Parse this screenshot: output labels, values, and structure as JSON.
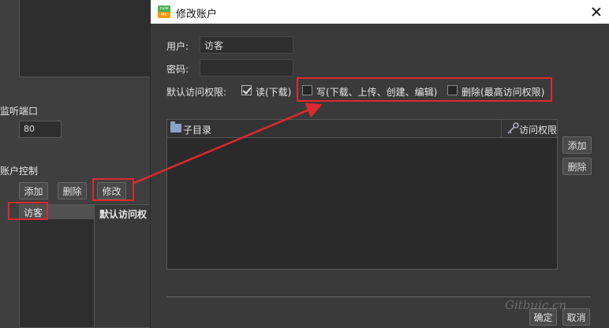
{
  "background": {
    "port_label": "监听端口",
    "port_value": "80",
    "account_label": "账户控制",
    "add_button": "添加",
    "delete_button": "删除",
    "modify_button": "修改",
    "accounts": [
      "访客"
    ],
    "default_perm_header": "默认访问权"
  },
  "dialog": {
    "title": "修改账户",
    "logo_top": "cute",
    "logo_bottom": "ME",
    "user_label": "用户:",
    "user_value": "访客",
    "password_label": "密码:",
    "password_value": "",
    "default_perm_label": "默认访问权限:",
    "perm_read": {
      "label": "读(下载)",
      "checked": true
    },
    "perm_write": {
      "label": "写(下载、上传、创建、编辑)",
      "checked": false
    },
    "perm_delete": {
      "label": "删除(最高访问权限)",
      "checked": false
    },
    "table": {
      "col_subdir": "子目录",
      "col_perm": "访问权限",
      "rows": []
    },
    "add_button": "添加",
    "delete_button": "删除",
    "ok_button": "确定",
    "cancel_button": "取消"
  },
  "watermark": "Gitbuic.cn",
  "colors": {
    "annotation_red": "#e0282e",
    "dialog_bg": "#3a3a3a",
    "titlebar_bg": "#ffffff"
  }
}
